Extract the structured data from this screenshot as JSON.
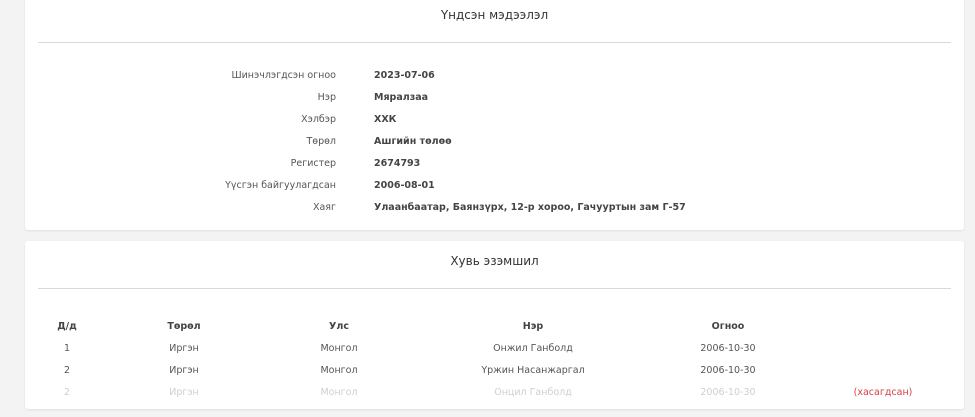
{
  "basic_info": {
    "title": "Үндсэн мэдээлэл",
    "fields": [
      {
        "label": "Шинэчлэгдсэн огноо",
        "value": "2023-07-06"
      },
      {
        "label": "Нэр",
        "value": "Мяралзаа"
      },
      {
        "label": "Хэлбэр",
        "value": "ХХК"
      },
      {
        "label": "Төрөл",
        "value": "Ашгийн төлөө"
      },
      {
        "label": "Регистер",
        "value": "2674793"
      },
      {
        "label": "Үүсгэн байгуулагдсан",
        "value": "2006-08-01"
      },
      {
        "label": "Хаяг",
        "value": "Улаанбаатар, Баянзүрх, 12-р хороо, Гачууртын зам Г-57"
      }
    ]
  },
  "ownership": {
    "title": "Хувь эзэмшил",
    "columns": [
      "Д/д",
      "Төрөл",
      "Улс",
      "Нэр",
      "Огноо"
    ],
    "rows": [
      {
        "no": "1",
        "type": "Иргэн",
        "country": "Монгол",
        "name": "Онжил Ганболд",
        "date": "2006-10-30",
        "status": ""
      },
      {
        "no": "2",
        "type": "Иргэн",
        "country": "Монгол",
        "name": "Үржин Насанжаргал",
        "date": "2006-10-30",
        "status": ""
      },
      {
        "no": "2",
        "type": "Иргэн",
        "country": "Монгол",
        "name": "Онцил Ганболд",
        "date": "2006-10-30",
        "status": "(хасагдсан)"
      }
    ]
  },
  "colors": {
    "background": "#f3f3f3",
    "card": "#ffffff",
    "removed_text": "#cfcfcf",
    "removed_status": "#d94040"
  }
}
